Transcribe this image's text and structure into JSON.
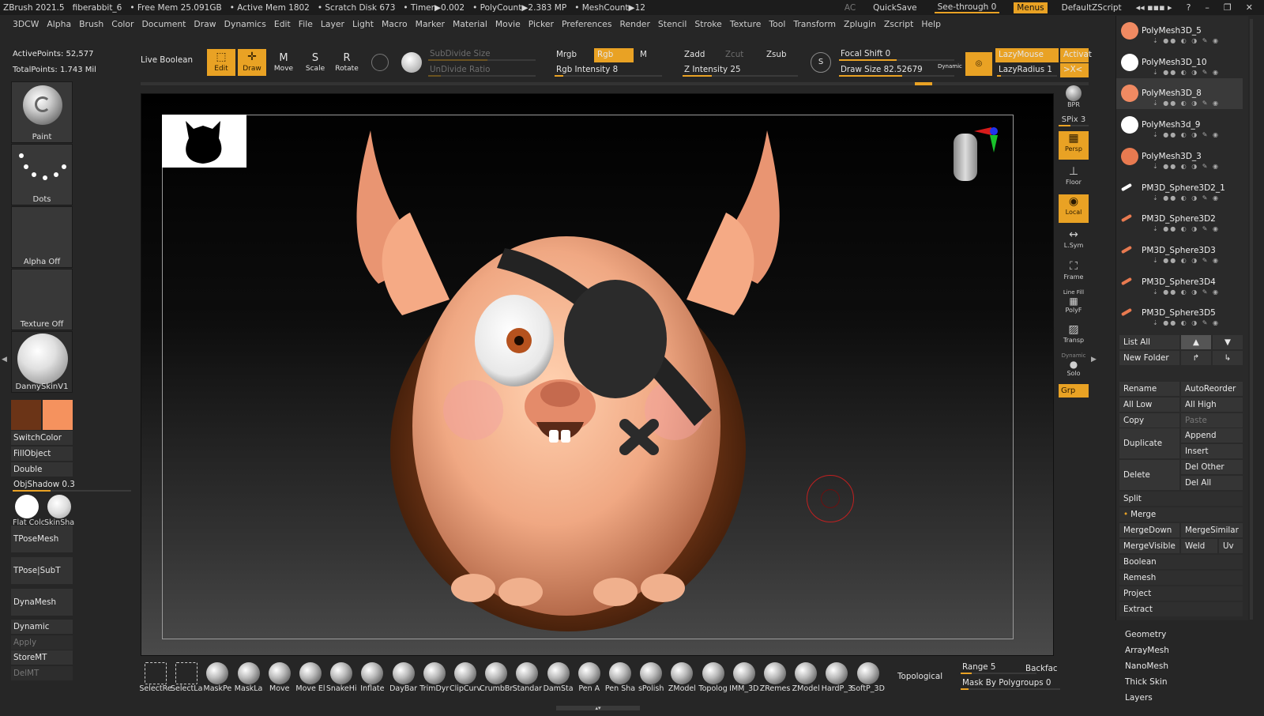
{
  "titlebar": {
    "app": "ZBrush 2021.5",
    "file": "fiberabbit_6",
    "free_mem": "• Free Mem 25.091GB",
    "active_mem": "• Active Mem 1802",
    "scratch": "• Scratch Disk 673",
    "timer": "• Timer▶0.002",
    "polycount": "• PolyCount▶2.383 MP",
    "meshcount": "• MeshCount▶12",
    "ac": "AC",
    "quicksave": "QuickSave",
    "see_through": "See-through  0",
    "menus": "Menus",
    "script": "DefaultZScript"
  },
  "menubar": [
    "3DCW",
    "Alpha",
    "Brush",
    "Color",
    "Document",
    "Draw",
    "Dynamics",
    "Edit",
    "File",
    "Layer",
    "Light",
    "Macro",
    "Marker",
    "Material",
    "Movie",
    "Picker",
    "Preferences",
    "Render",
    "Stencil",
    "Stroke",
    "Texture",
    "Tool",
    "Transform",
    "Zplugin",
    "Zscript",
    "Help"
  ],
  "stats": {
    "active_points": "ActivePoints: 52,577",
    "total_points": "TotalPoints: 1.743 Mil"
  },
  "left": {
    "brush": "Paint",
    "stroke": "Dots",
    "alpha": "Alpha Off",
    "texture": "Texture Off",
    "material": "DannySkinV1",
    "main_color": "#6b3417",
    "secondary_color": "#f5925e",
    "switch_color": "SwitchColor",
    "fill_object": "FillObject",
    "double": "Double",
    "obj_shadow": "ObjShadow 0.3",
    "flat_color": "Flat Colc",
    "skin_shade": "SkinSha",
    "tpose_mesh": "TPoseMesh",
    "tpose_subt": "TPose|SubT",
    "dynamesh": "DynaMesh",
    "dynamic": "Dynamic",
    "apply": "Apply",
    "store_mt": "StoreMT",
    "del_mt": "DelMT"
  },
  "toolbar": {
    "live_boolean": "Live Boolean",
    "edit": "Edit",
    "draw": "Draw",
    "move": "Move",
    "scale": "Scale",
    "rotate": "Rotate",
    "subdivide_size": "SubDivide Size",
    "undivide_ratio": "UnDivide Ratio",
    "mrgb": "Mrgb",
    "rgb": "Rgb",
    "m": "M",
    "rgb_intensity": "Rgb Intensity 8",
    "zadd": "Zadd",
    "zcut": "Zcut",
    "zsub": "Zsub",
    "z_intensity": "Z Intensity 25",
    "focal_shift": "Focal Shift 0",
    "draw_size": "Draw Size 82.52679",
    "dynamic": "Dynamic",
    "lazymouse": "LazyMouse",
    "lazyradius": "LazyRadius 1",
    "activate": "Activat"
  },
  "right_toolbar": {
    "bpr": "BPR",
    "spix": "SPix 3",
    "persp": "Persp",
    "floor": "Floor",
    "local": "Local",
    "lsym": "L.Sym",
    "frame": "Frame",
    "polyf": "PolyF",
    "line_fill": "Line Fill",
    "transp": "Transp",
    "solo": "Solo",
    "dynamic": "Dynamic",
    "grp": "Grp"
  },
  "subtools": [
    {
      "name": "PolyMesh3D_5"
    },
    {
      "name": "PolyMesh3D_10"
    },
    {
      "name": "PolyMesh3D_8"
    },
    {
      "name": "PolyMesh3d_9"
    },
    {
      "name": "PolyMesh3D_3"
    },
    {
      "name": "PM3D_Sphere3D2_1"
    },
    {
      "name": "PM3D_Sphere3D2"
    },
    {
      "name": "PM3D_Sphere3D3"
    },
    {
      "name": "PM3D_Sphere3D4"
    },
    {
      "name": "PM3D_Sphere3D5"
    }
  ],
  "subtool_panel": {
    "list_all": "List All",
    "new_folder": "New Folder",
    "rename": "Rename",
    "autoreorder": "AutoReorder",
    "all_low": "All Low",
    "all_high": "All High",
    "copy": "Copy",
    "paste": "Paste",
    "duplicate": "Duplicate",
    "append": "Append",
    "insert": "Insert",
    "delete": "Delete",
    "del_other": "Del Other",
    "del_all": "Del All",
    "split": "Split",
    "merge": "Merge",
    "merge_down": "MergeDown",
    "merge_similar": "MergeSimilar",
    "merge_visible": "MergeVisible",
    "weld": "Weld",
    "uv": "Uv",
    "boolean": "Boolean",
    "remesh": "Remesh",
    "project": "Project",
    "extract": "Extract",
    "geometry": "Geometry",
    "arraymesh": "ArrayMesh",
    "nanomesh": "NanoMesh",
    "thick_skin": "Thick Skin",
    "layers": "Layers"
  },
  "shelf": [
    "SelectRe",
    "SelectLa",
    "MaskPe",
    "MaskLa",
    "Move",
    "Move El",
    "SnakeHi",
    "Inflate",
    "DayBar",
    "TrimDyr",
    "ClipCurv",
    "CrumbBr",
    "Standar",
    "DamSta",
    "Pen A",
    "Pen Sha",
    "sPolish",
    "ZModel",
    "Topolog",
    "IMM_3D",
    "ZRemes",
    "ZModel",
    "HardP_3",
    "SoftP_3D"
  ],
  "shelf_right": {
    "topological": "Topological",
    "range": "Range 5",
    "backface": "Backfac",
    "mask_by_polygroups": "Mask By Polygroups 0"
  }
}
